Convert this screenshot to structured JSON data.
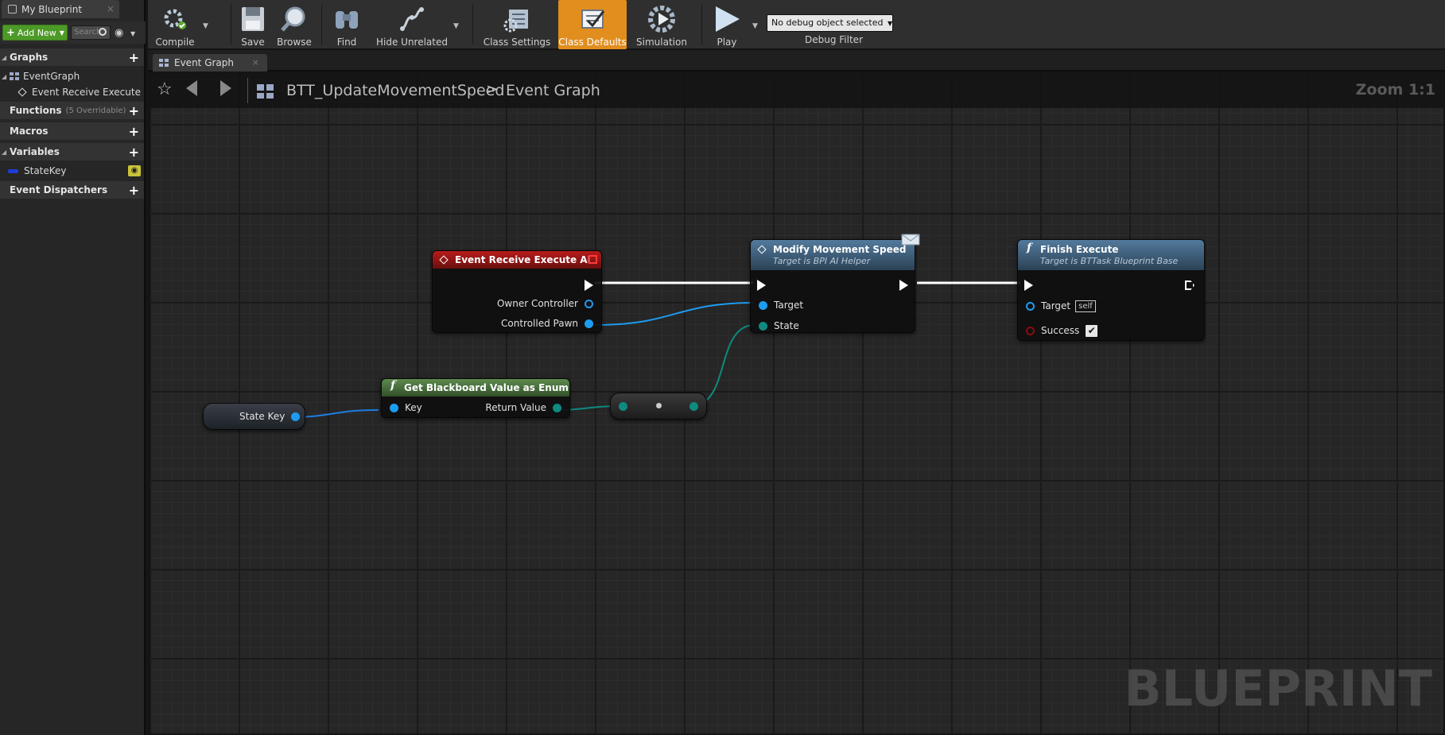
{
  "left_panel": {
    "tab_title": "My Blueprint",
    "tab_close": "×",
    "add_new_label": "Add New",
    "search_placeholder": "Search",
    "sections": {
      "graphs": "Graphs",
      "functions": "Functions",
      "functions_sub": "(5 Overridable)",
      "macros": "Macros",
      "variables": "Variables",
      "event_dispatchers": "Event Dispatchers"
    },
    "graph_items": [
      "EventGraph",
      "Event Receive Execute"
    ],
    "variable_items": [
      "StateKey"
    ]
  },
  "toolbar": {
    "compile": "Compile",
    "save": "Save",
    "browse": "Browse",
    "find": "Find",
    "hide_unrelated": "Hide Unrelated",
    "class_settings": "Class Settings",
    "class_defaults": "Class Defaults",
    "simulation": "Simulation",
    "play": "Play",
    "debug_object": "No debug object selected",
    "debug_filter": "Debug Filter"
  },
  "graph_tab": {
    "label": "Event Graph",
    "close": "×"
  },
  "breadcrumb": {
    "blueprint": "BTT_UpdateMovementSpeed",
    "separator": ">",
    "graph": "Event Graph"
  },
  "zoom": "Zoom 1:1",
  "watermark": "BLUEPRINT",
  "nodes": {
    "event_receive": {
      "title": "Event Receive Execute AI",
      "pins": [
        "Owner Controller",
        "Controlled Pawn"
      ]
    },
    "modify_speed": {
      "title": "Modify Movement Speed",
      "subtitle": "Target is BPI AI Helper",
      "pins": [
        "Target",
        "State"
      ]
    },
    "finish_execute": {
      "title": "Finish Execute",
      "subtitle": "Target is BTTask Blueprint Base",
      "pins": [
        "Target",
        "Success"
      ],
      "target_default": "self",
      "success_checked": true
    },
    "get_blackboard": {
      "title": "Get Blackboard Value as Enum",
      "pins": [
        "Key",
        "Return Value"
      ]
    },
    "state_key": {
      "label": "State Key"
    }
  },
  "colors": {
    "accent_orange": "#e18e1e",
    "exec_wire": "#ffffff",
    "object_wire": "#1d9bf0",
    "struct_wire": "#0e8a7e",
    "event_header": "#b71b1b",
    "function_header": "#537a9c",
    "pure_header": "#5d8a4e"
  }
}
